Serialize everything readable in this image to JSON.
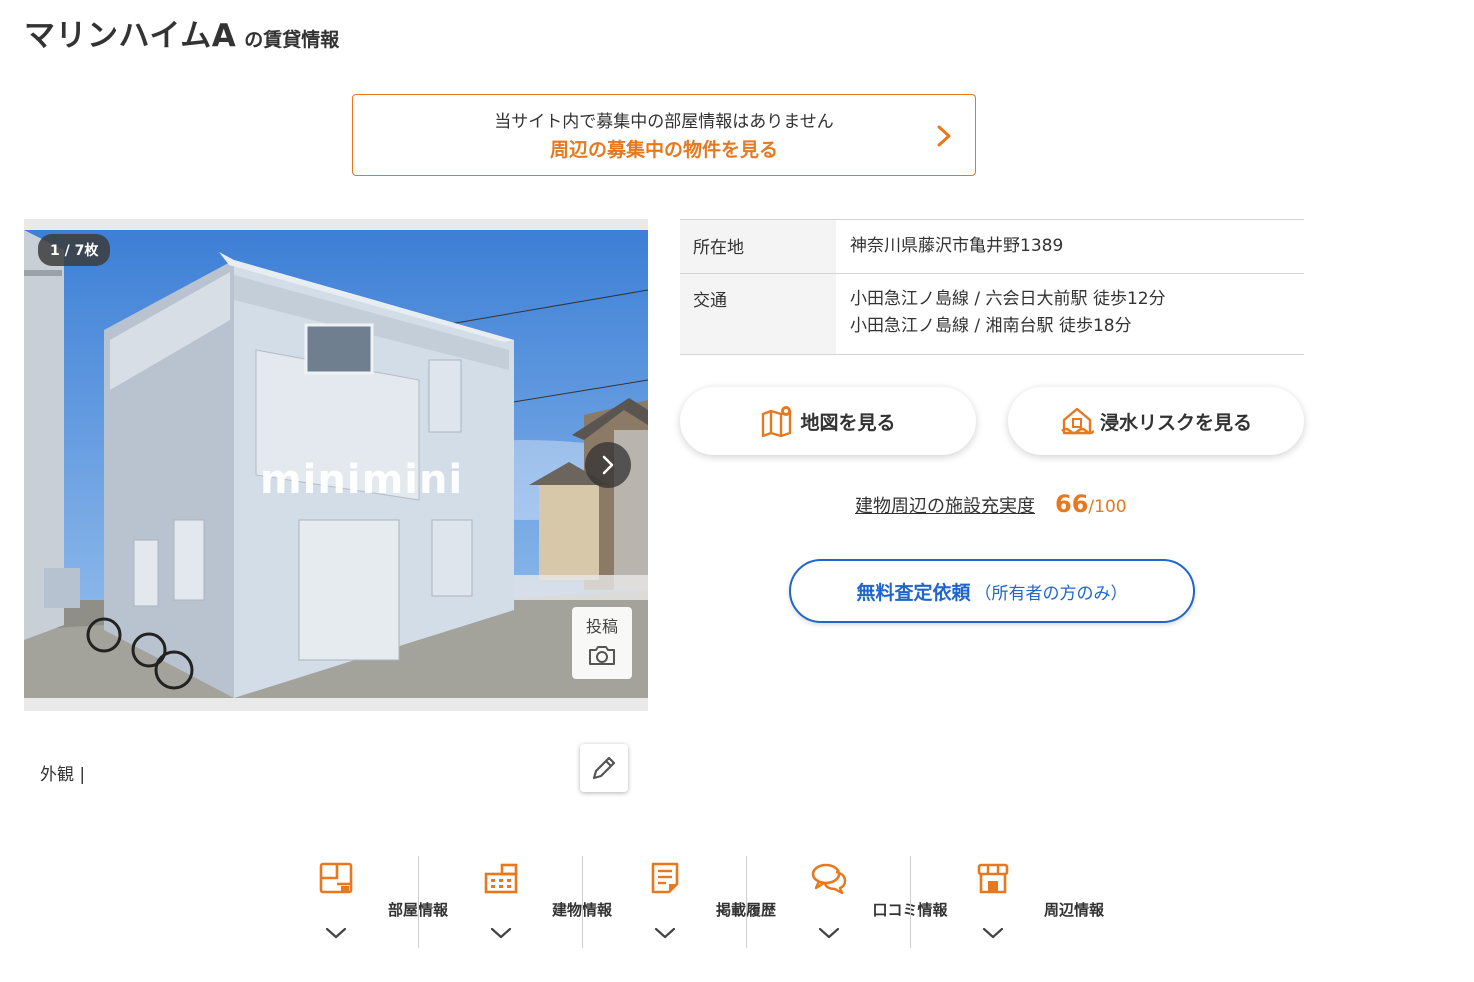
{
  "header": {
    "property_name": "マリンハイムA",
    "suffix": "の賃貸情報"
  },
  "notice": {
    "message": "当サイト内で募集中の部屋情報はありません",
    "link": "周辺の募集中の物件を見る"
  },
  "gallery": {
    "counter": "1 / 7枚",
    "watermark": "minimini",
    "post_label": "投稿",
    "caption": "外観 |"
  },
  "info": {
    "address_label": "所在地",
    "address_value": "神奈川県藤沢市亀井野1389",
    "transit_label": "交通",
    "transit_lines": [
      "小田急江ノ島線 / 六会日大前駅 徒歩12分",
      "小田急江ノ島線 / 湘南台駅 徒歩18分"
    ]
  },
  "actions": {
    "map": "地図を見る",
    "flood": "浸水リスクを見る"
  },
  "facility": {
    "label": "建物周辺の施設充実度",
    "score": "66",
    "max": "/100"
  },
  "appraisal": {
    "main": "無料査定依頼",
    "sub": "（所有者の方のみ）"
  },
  "tabs": [
    {
      "label": "部屋情報",
      "icon": "floor-plan-icon"
    },
    {
      "label": "建物情報",
      "icon": "building-icon"
    },
    {
      "label": "掲載履歴",
      "icon": "document-icon"
    },
    {
      "label": "口コミ情報",
      "icon": "chat-bubbles-icon"
    },
    {
      "label": "周辺情報",
      "icon": "storefront-icon"
    }
  ],
  "colors": {
    "accent": "#e8781e",
    "link_blue": "#1f66cc"
  }
}
